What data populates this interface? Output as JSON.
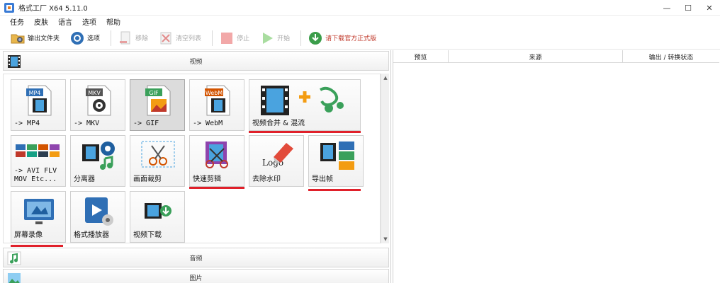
{
  "window": {
    "title": "格式工厂 X64 5.11.0",
    "controls": [
      "—",
      "☐",
      "✕"
    ]
  },
  "menu": {
    "items": [
      "任务",
      "皮肤",
      "语言",
      "选项",
      "帮助"
    ]
  },
  "toolbar": {
    "output_folder": "输出文件夹",
    "options": "选项",
    "remove": "移除",
    "clear_list": "清空列表",
    "stop": "停止",
    "start": "开始",
    "download_official": "请下载官方正式版"
  },
  "left_panel": {
    "video_section": "视频",
    "audio_section": "音频",
    "image_section": "图片",
    "tiles": [
      {
        "label": "-> MP4",
        "badge": "MP4"
      },
      {
        "label": "-> MKV",
        "badge": "MKV"
      },
      {
        "label": "-> GIF",
        "badge": "GIF",
        "selected": true
      },
      {
        "label": "-> WebM",
        "badge": "WebM"
      },
      {
        "label": "视频合并 & 混流"
      },
      {
        "label": "-> AVI FLV\nMOV Etc..."
      },
      {
        "label": "分离器"
      },
      {
        "label": "画面裁剪"
      },
      {
        "label": "快速剪辑"
      },
      {
        "label": "去除水印",
        "logo_text": "Logo"
      },
      {
        "label": "导出帧"
      },
      {
        "label": "屏幕录像"
      },
      {
        "label": "格式播放器"
      },
      {
        "label": "视频下载"
      }
    ],
    "highlight_color": "#e0202a"
  },
  "right_panel": {
    "columns": [
      "预览",
      "来源",
      "输出 / 转换状态"
    ]
  }
}
